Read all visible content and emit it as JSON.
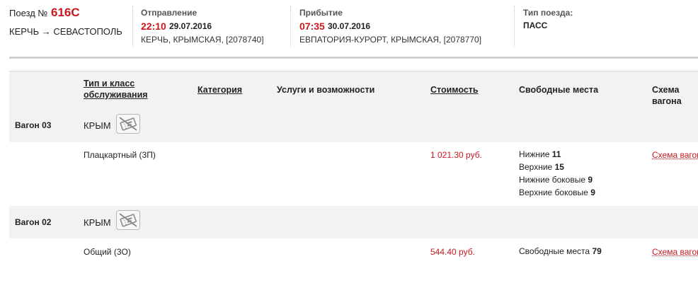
{
  "train": {
    "label": "Поезд №",
    "number": "616С",
    "route": "КЕРЧЬ → СЕВАСТОПОЛЬ"
  },
  "departure": {
    "label": "Отправление",
    "time": "22:10",
    "date": "29.07.2016",
    "station": "КЕРЧЬ, КРЫМСКАЯ, [2078740]"
  },
  "arrival": {
    "label": "Прибытие",
    "time": "07:35",
    "date": "30.07.2016",
    "station": "ЕВПАТОРИЯ-КУРОРТ, КРЫМСКАЯ, [2078770]"
  },
  "train_type": {
    "label": "Тип поезда:",
    "value": "ПАСС"
  },
  "columns": {
    "type_class_line1": "Тип и класс",
    "type_class_line2": "обслуживания",
    "category": "Категория",
    "services": "Услуги и возможности",
    "price": "Стоимость",
    "free_seats": "Свободные места",
    "scheme": "Схема вагона"
  },
  "wagons": [
    {
      "label": "Вагон 03",
      "carrier": "КРЫМ",
      "badge_icon": "no-ticket-icon",
      "class": "Плацкартный (3П)",
      "price": "1 021.30 руб.",
      "seats": [
        {
          "label": "Нижние",
          "count": "11"
        },
        {
          "label": "Верхние",
          "count": "15"
        },
        {
          "label": "Нижние боковые",
          "count": "9"
        },
        {
          "label": "Верхние боковые",
          "count": "9"
        }
      ],
      "scheme_link": "Схема вагона"
    },
    {
      "label": "Вагон 02",
      "carrier": "КРЫМ",
      "badge_icon": "no-ticket-icon",
      "class": "Общий (3О)",
      "price": "544.40 руб.",
      "seats": [
        {
          "label": "Свободные места",
          "count": "79"
        }
      ],
      "scheme_link": "Схема вагона"
    }
  ],
  "colors": {
    "accent_red": "#c8191e",
    "row_gray": "#f2f2f2",
    "divider_gray": "#cfcfcf"
  }
}
